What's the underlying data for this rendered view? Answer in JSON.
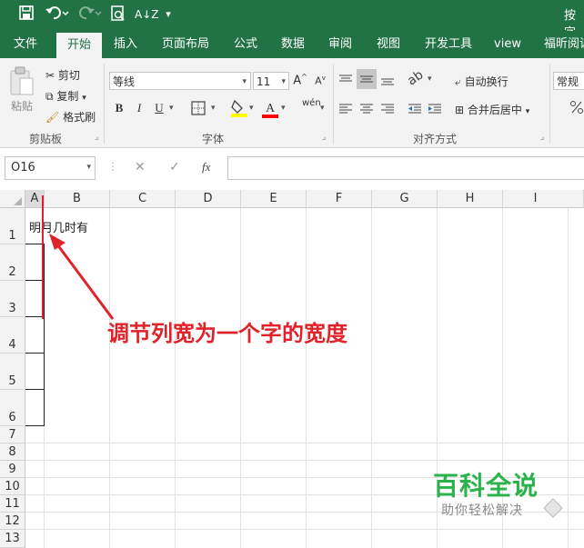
{
  "window": {
    "title_partial": "按字"
  },
  "quick_access": {
    "save_icon": "save-icon",
    "undo_icon": "undo-icon",
    "redo_icon": "redo-icon",
    "preview_icon": "print-preview-icon",
    "sort_icon": "sort-icon",
    "more_icon": "customize-toolbar-icon"
  },
  "tabs": [
    {
      "label": "文件",
      "active": false
    },
    {
      "label": "开始",
      "active": true
    },
    {
      "label": "插入",
      "active": false
    },
    {
      "label": "页面布局",
      "active": false
    },
    {
      "label": "公式",
      "active": false
    },
    {
      "label": "数据",
      "active": false
    },
    {
      "label": "审阅",
      "active": false
    },
    {
      "label": "视图",
      "active": false
    },
    {
      "label": "开发工具",
      "active": false
    },
    {
      "label": "view",
      "active": false
    },
    {
      "label": "福昕阅读",
      "active": false
    }
  ],
  "ribbon": {
    "clipboard": {
      "paste_label": "粘贴",
      "cut_label": "剪切",
      "copy_label": "复制",
      "format_painter_label": "格式刷",
      "group_label": "剪贴板"
    },
    "font": {
      "font_name": "等线",
      "font_size": "11",
      "bold": "B",
      "italic": "I",
      "underline": "U",
      "grow": "A",
      "shrink": "A",
      "pinyin": "wén",
      "group_label": "字体",
      "fill_color": "#ffff00",
      "font_color": "#ff0000"
    },
    "alignment": {
      "wrap_label": "自动换行",
      "merge_label": "合并后居中",
      "group_label": "对齐方式"
    },
    "number": {
      "format": "常规"
    }
  },
  "formula_bar": {
    "name_box": "O16",
    "cancel": "✕",
    "enter": "✓",
    "fx": "fx",
    "value": ""
  },
  "sheet": {
    "columns": [
      "A",
      "B",
      "C",
      "D",
      "E",
      "F",
      "G",
      "H",
      "I"
    ],
    "rows": [
      "1",
      "2",
      "3",
      "4",
      "5",
      "6",
      "7",
      "8",
      "9",
      "10",
      "11",
      "12",
      "13"
    ],
    "cells": {
      "A1": "明月几时有"
    }
  },
  "annotation": {
    "text": "调节列宽为一个字的宽度",
    "color": "#e0232a"
  },
  "watermark": {
    "title": "百科全说",
    "subtitle": "助你轻松解决",
    "color": "#2bb24c"
  }
}
